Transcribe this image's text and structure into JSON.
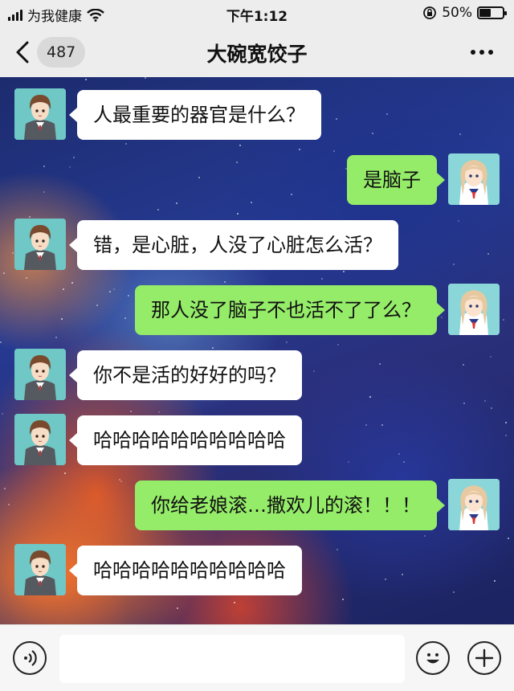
{
  "status_bar": {
    "carrier": "为我健康",
    "time": "下午1:12",
    "battery_percent": "50%",
    "battery_level": 0.5
  },
  "nav": {
    "unread_count": "487",
    "title": "大碗宽饺子",
    "back_icon": "chevron-left-icon",
    "more_icon": "more-dots-icon"
  },
  "colors": {
    "incoming_bubble": "#ffffff",
    "outgoing_bubble": "#95ec69",
    "bar_background": "#ededed"
  },
  "messages": [
    {
      "side": "left",
      "text": "人最重要的器官是什么？"
    },
    {
      "side": "right",
      "text": "是脑子"
    },
    {
      "side": "left",
      "text": "错，是心脏，人没了心脏怎么活？"
    },
    {
      "side": "right",
      "text": "那人没了脑子不也活不了了么？"
    },
    {
      "side": "left",
      "text": "你不是活的好好的吗？"
    },
    {
      "side": "left",
      "text": "哈哈哈哈哈哈哈哈哈哈"
    },
    {
      "side": "right",
      "text": "你给老娘滚…撒欢儿的滚！！！"
    },
    {
      "side": "left",
      "text": "哈哈哈哈哈哈哈哈哈哈"
    }
  ],
  "input_bar": {
    "placeholder": "",
    "voice_icon": "voice-icon",
    "emoji_icon": "emoji-icon",
    "plus_icon": "plus-icon"
  }
}
